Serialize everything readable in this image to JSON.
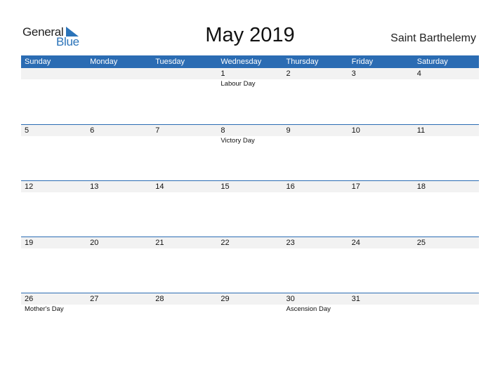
{
  "logo": {
    "general": "General",
    "blue": "Blue"
  },
  "title": "May 2019",
  "country": "Saint Barthelemy",
  "colors": {
    "header": "#2b6cb3",
    "logo_blue": "#2a73b9",
    "day_bar": "#f2f2f2"
  },
  "weekdays": [
    "Sunday",
    "Monday",
    "Tuesday",
    "Wednesday",
    "Thursday",
    "Friday",
    "Saturday"
  ],
  "weeks": [
    {
      "days": [
        "",
        "",
        "",
        "1",
        "2",
        "3",
        "4"
      ],
      "events": [
        "",
        "",
        "",
        "Labour Day",
        "",
        "",
        ""
      ]
    },
    {
      "days": [
        "5",
        "6",
        "7",
        "8",
        "9",
        "10",
        "11"
      ],
      "events": [
        "",
        "",
        "",
        "Victory Day",
        "",
        "",
        ""
      ]
    },
    {
      "days": [
        "12",
        "13",
        "14",
        "15",
        "16",
        "17",
        "18"
      ],
      "events": [
        "",
        "",
        "",
        "",
        "",
        "",
        ""
      ]
    },
    {
      "days": [
        "19",
        "20",
        "21",
        "22",
        "23",
        "24",
        "25"
      ],
      "events": [
        "",
        "",
        "",
        "",
        "",
        "",
        ""
      ]
    },
    {
      "days": [
        "26",
        "27",
        "28",
        "29",
        "30",
        "31",
        ""
      ],
      "events": [
        "Mother's Day",
        "",
        "",
        "",
        "Ascension Day",
        "",
        ""
      ]
    }
  ]
}
